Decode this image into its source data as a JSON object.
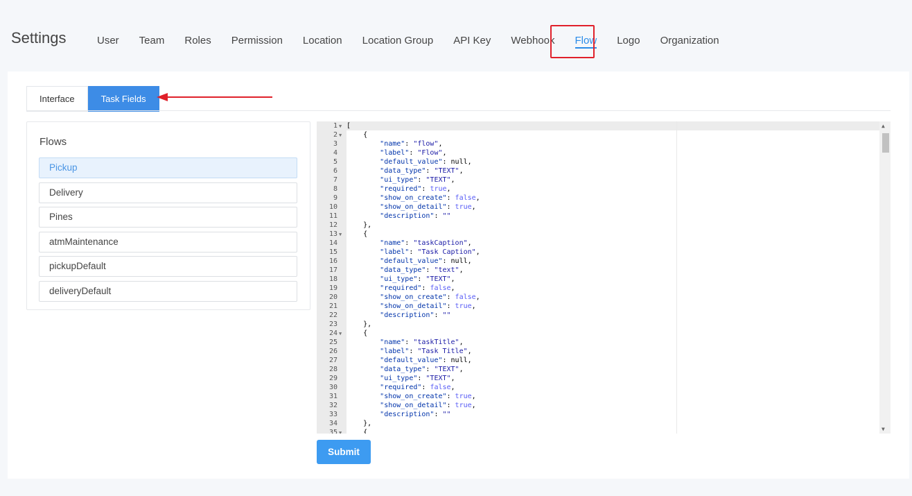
{
  "page_title": "Settings",
  "nav": [
    {
      "label": "User",
      "active": false
    },
    {
      "label": "Team",
      "active": false
    },
    {
      "label": "Roles",
      "active": false
    },
    {
      "label": "Permission",
      "active": false
    },
    {
      "label": "Location",
      "active": false
    },
    {
      "label": "Location Group",
      "active": false
    },
    {
      "label": "API Key",
      "active": false
    },
    {
      "label": "Webhook",
      "active": false
    },
    {
      "label": "Flow",
      "active": true
    },
    {
      "label": "Logo",
      "active": false
    },
    {
      "label": "Organization",
      "active": false
    }
  ],
  "subtabs": [
    {
      "label": "Interface",
      "active": false
    },
    {
      "label": "Task Fields",
      "active": true
    }
  ],
  "flows": {
    "title": "Flows",
    "items": [
      {
        "label": "Pickup",
        "active": true
      },
      {
        "label": "Delivery",
        "active": false
      },
      {
        "label": "Pines",
        "active": false
      },
      {
        "label": "atmMaintenance",
        "active": false
      },
      {
        "label": "pickupDefault",
        "active": false
      },
      {
        "label": "deliveryDefault",
        "active": false
      }
    ]
  },
  "editor": {
    "lines": [
      "[",
      "    {",
      "        \"name\": \"flow\",",
      "        \"label\": \"Flow\",",
      "        \"default_value\": null,",
      "        \"data_type\": \"TEXT\",",
      "        \"ui_type\": \"TEXT\",",
      "        \"required\": true,",
      "        \"show_on_create\": false,",
      "        \"show_on_detail\": true,",
      "        \"description\": \"\"",
      "    },",
      "    {",
      "        \"name\": \"taskCaption\",",
      "        \"label\": \"Task Caption\",",
      "        \"default_value\": null,",
      "        \"data_type\": \"text\",",
      "        \"ui_type\": \"TEXT\",",
      "        \"required\": false,",
      "        \"show_on_create\": false,",
      "        \"show_on_detail\": true,",
      "        \"description\": \"\"",
      "    },",
      "    {",
      "        \"name\": \"taskTitle\",",
      "        \"label\": \"Task Title\",",
      "        \"default_value\": null,",
      "        \"data_type\": \"TEXT\",",
      "        \"ui_type\": \"TEXT\",",
      "        \"required\": false,",
      "        \"show_on_create\": true,",
      "        \"show_on_detail\": true,",
      "        \"description\": \"\"",
      "    },",
      "    {"
    ],
    "fold_lines": [
      1,
      2,
      13,
      24,
      35
    ]
  },
  "submit_label": "Submit",
  "colors": {
    "accent": "#3d8ce6",
    "highlight_box": "#e0202a",
    "annotation_arrow": "#e0202a"
  }
}
